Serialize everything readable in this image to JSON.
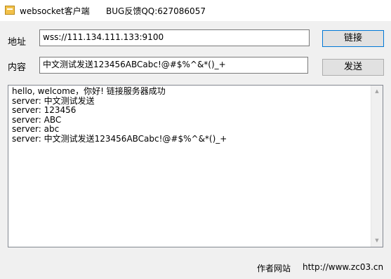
{
  "window": {
    "title": "websocket客户端",
    "bug_feedback": "BUG反馈QQ:627086057"
  },
  "address": {
    "label": "地址",
    "value": "wss://111.134.111.133:9100",
    "connect_label": "链接"
  },
  "content": {
    "label": "内容",
    "value": "中文测试发送123456ABCabc!@#$%^&*()_+",
    "send_label": "发送"
  },
  "log": {
    "lines": [
      "hello, welcome，你好! 链接服务器成功",
      "server: 中文测试发送",
      "server: 123456",
      "server: ABC",
      "server: abc",
      "server: 中文测试发送123456ABCabc!@#$%^&*()_+"
    ]
  },
  "footer": {
    "author_label": "作者网站",
    "author_link": "http://www.zc03.cn"
  },
  "icons": {
    "app": "app-icon",
    "scroll_up": "scroll-up-icon",
    "scroll_down": "scroll-down-icon"
  }
}
